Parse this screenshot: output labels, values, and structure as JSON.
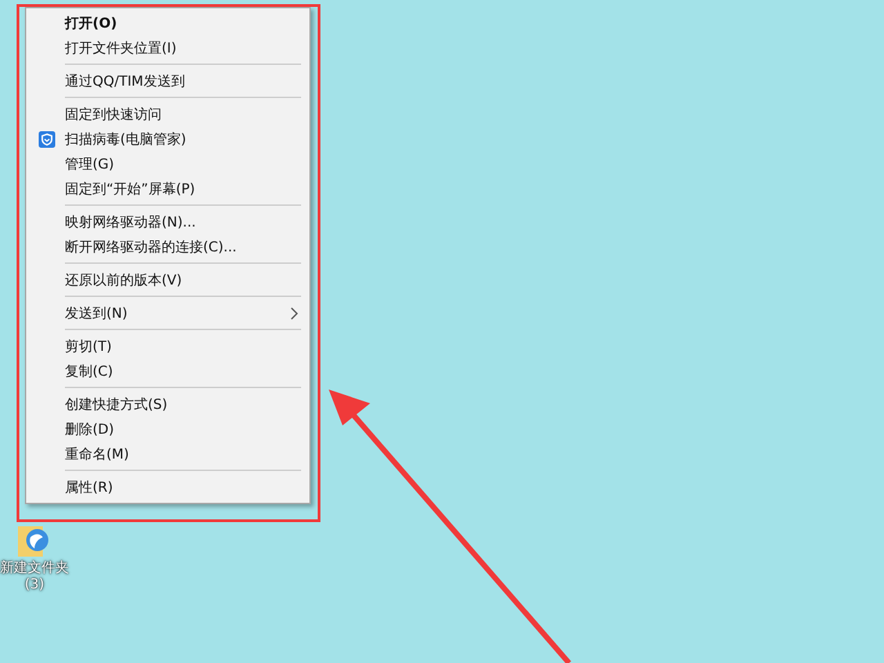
{
  "context_menu": {
    "groups": [
      [
        {
          "label": "打开(O)",
          "default": true
        },
        {
          "label": "打开文件夹位置(I)",
          "default": false
        }
      ],
      [
        {
          "label": "通过QQ/TIM发送到",
          "default": false
        }
      ],
      [
        {
          "label": "固定到快速访问",
          "default": false
        },
        {
          "label": "扫描病毒(电脑管家)",
          "default": false,
          "kind": "scan"
        },
        {
          "label": "管理(G)",
          "default": false
        },
        {
          "label": "固定到“开始”屏幕(P)",
          "default": false
        }
      ],
      [
        {
          "label": "映射网络驱动器(N)...",
          "default": false
        },
        {
          "label": "断开网络驱动器的连接(C)...",
          "default": false
        }
      ],
      [
        {
          "label": "还原以前的版本(V)",
          "default": false
        }
      ],
      [
        {
          "label": "发送到(N)",
          "default": false,
          "kind": "submenu"
        }
      ],
      [
        {
          "label": "剪切(T)",
          "default": false
        },
        {
          "label": "复制(C)",
          "default": false
        }
      ],
      [
        {
          "label": "创建快捷方式(S)",
          "default": false
        },
        {
          "label": "删除(D)",
          "default": false
        },
        {
          "label": "重命名(M)",
          "default": false
        }
      ],
      [
        {
          "label": "属性(R)",
          "default": false
        }
      ]
    ]
  },
  "desktop_icons": [
    {
      "label": "新建文件夹 (3)"
    }
  ]
}
